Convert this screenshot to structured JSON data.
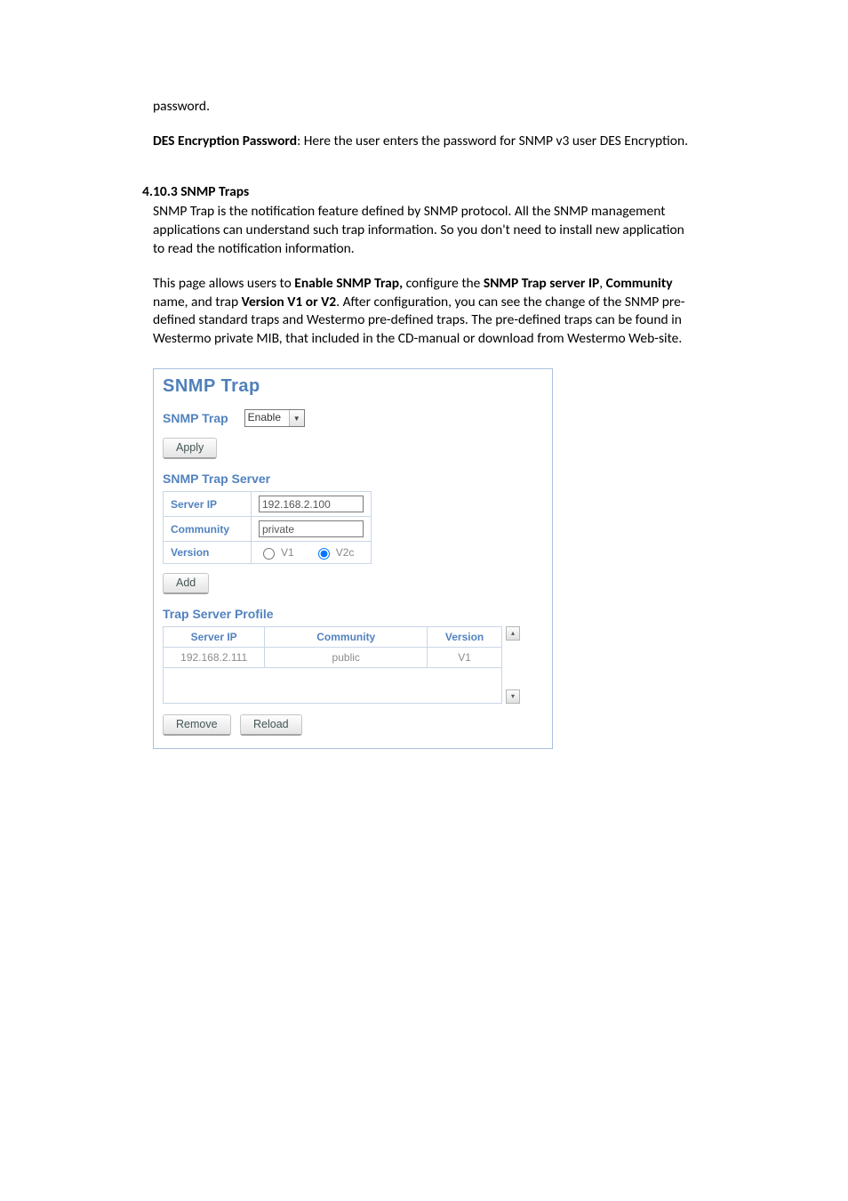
{
  "doc": {
    "p1": "password.",
    "p2b": "DES Encryption Password",
    "p2": ": Here the user enters the password for SNMP v3 user DES Encryption.",
    "heading": "4.10.3  SNMP Traps",
    "p3": "SNMP Trap is the notification feature defined by SNMP protocol. All the SNMP management applications can understand such trap information. So you don't need to install new application to read the notification information.",
    "p4a": "This page allows users to ",
    "p4b": "Enable SNMP Trap,",
    "p4c": " configure the ",
    "p4d": "SNMP Trap server IP",
    "p4e": ", ",
    "p4f": "Community",
    "p4g": " name, and trap ",
    "p4h": "Version V1 or V2",
    "p4i": ". After configuration, you can see the change of the SNMP pre-defined standard traps and Westermo pre-defined traps. The pre-defined traps can be found in Westermo private MIB, that included in the CD-manual or download from Westermo Web-site."
  },
  "ui": {
    "title": "SNMP Trap",
    "snmpTrapLabel": "SNMP Trap",
    "enableDropdown": "Enable",
    "applyBtn": "Apply",
    "trapServerHead": "SNMP Trap Server",
    "serverIpLabel": "Server IP",
    "serverIpValue": "192.168.2.100",
    "communityLabel": "Community",
    "communityValue": "private",
    "versionLabel": "Version",
    "v1Label": "V1",
    "v2cLabel": "V2c",
    "addBtn": "Add",
    "profileHead": "Trap Server Profile",
    "col1": "Server IP",
    "col2": "Community",
    "col3": "Version",
    "row1_ip": "192.168.2.111",
    "row1_comm": "public",
    "row1_ver": "V1",
    "removeBtn": "Remove",
    "reloadBtn": "Reload"
  }
}
